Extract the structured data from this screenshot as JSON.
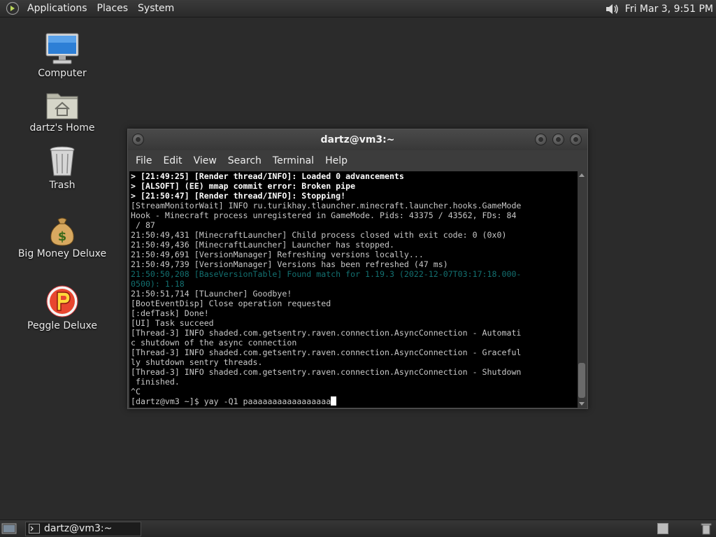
{
  "top_panel": {
    "menus": [
      "Applications",
      "Places",
      "System"
    ],
    "clock": "Fri Mar  3,  9:51 PM",
    "icons": [
      "gnome-foot-icon",
      "volume-icon"
    ]
  },
  "desktop": {
    "icons": [
      {
        "label": "Computer",
        "icon": "computer-icon"
      },
      {
        "label": "dartz's Home",
        "icon": "home-folder-icon"
      },
      {
        "label": "Trash",
        "icon": "trash-icon"
      },
      {
        "label": "Big Money Deluxe",
        "icon": "money-bag-icon"
      },
      {
        "label": "Peggle Deluxe",
        "icon": "peggle-icon"
      }
    ]
  },
  "window": {
    "title": "dartz@vm3:~",
    "menu": [
      "File",
      "Edit",
      "View",
      "Search",
      "Terminal",
      "Help"
    ],
    "lines": [
      {
        "text": "> [21:49:25] [Render thread/INFO]: Loaded 0 advancements",
        "style": "bold"
      },
      {
        "text": "> [ALSOFT] (EE) mmap commit error: Broken pipe",
        "style": "bold"
      },
      {
        "text": "> [21:50:47] [Render thread/INFO]: Stopping!",
        "style": "bold"
      },
      {
        "text": "[StreamMonitorWait] INFO ru.turikhay.tlauncher.minecraft.launcher.hooks.GameMode",
        "style": "normal"
      },
      {
        "text": "Hook - Minecraft process unregistered in GameMode. Pids: 43375 / 43562, FDs: 84",
        "style": "normal"
      },
      {
        "text": " / 87",
        "style": "normal"
      },
      {
        "text": "21:50:49,431 [MinecraftLauncher] Child process closed with exit code: 0 (0x0)",
        "style": "normal"
      },
      {
        "text": "21:50:49,436 [MinecraftLauncher] Launcher has stopped.",
        "style": "normal"
      },
      {
        "text": "21:50:49,691 [VersionManager] Refreshing versions locally...",
        "style": "normal"
      },
      {
        "text": "21:50:49,739 [VersionManager] Versions has been refreshed (47 ms)",
        "style": "normal"
      },
      {
        "text": "21:50:50,208 [BaseVersionTable] Found match for 1.19.3 (2022-12-07T03:17:18.000-",
        "style": "dim"
      },
      {
        "text": "0500): 1.18",
        "style": "dim"
      },
      {
        "text": "21:50:51,714 [TLauncher] Goodbye!",
        "style": "normal"
      },
      {
        "text": "[BootEventDisp] Close operation requested",
        "style": "normal"
      },
      {
        "text": "[:defTask] Done!",
        "style": "normal"
      },
      {
        "text": "[UI] Task succeed",
        "style": "normal"
      },
      {
        "text": "[Thread-3] INFO shaded.com.getsentry.raven.connection.AsyncConnection - Automati",
        "style": "normal"
      },
      {
        "text": "c shutdown of the async connection",
        "style": "normal"
      },
      {
        "text": "[Thread-3] INFO shaded.com.getsentry.raven.connection.AsyncConnection - Graceful",
        "style": "normal"
      },
      {
        "text": "ly shutdown sentry threads.",
        "style": "normal"
      },
      {
        "text": "[Thread-3] INFO shaded.com.getsentry.raven.connection.AsyncConnection - Shutdown",
        "style": "normal"
      },
      {
        "text": " finished.",
        "style": "normal"
      },
      {
        "text": "^C",
        "style": "normal"
      }
    ],
    "prompt": "[dartz@vm3 ~]$ ",
    "input_value": "yay -Q1 paaaaaaaaaaaaaaaaa"
  },
  "bottom_panel": {
    "task_label": "dartz@vm3:~",
    "icons": [
      "show-desktop-icon",
      "terminal-icon",
      "workspace-icon",
      "trash-applet-icon"
    ]
  },
  "colors": {
    "desktop_bg": "#2b2b2b",
    "terminal_bg": "#000000",
    "terminal_fg": "#c8c8c8",
    "dim_teal": "#137070"
  }
}
